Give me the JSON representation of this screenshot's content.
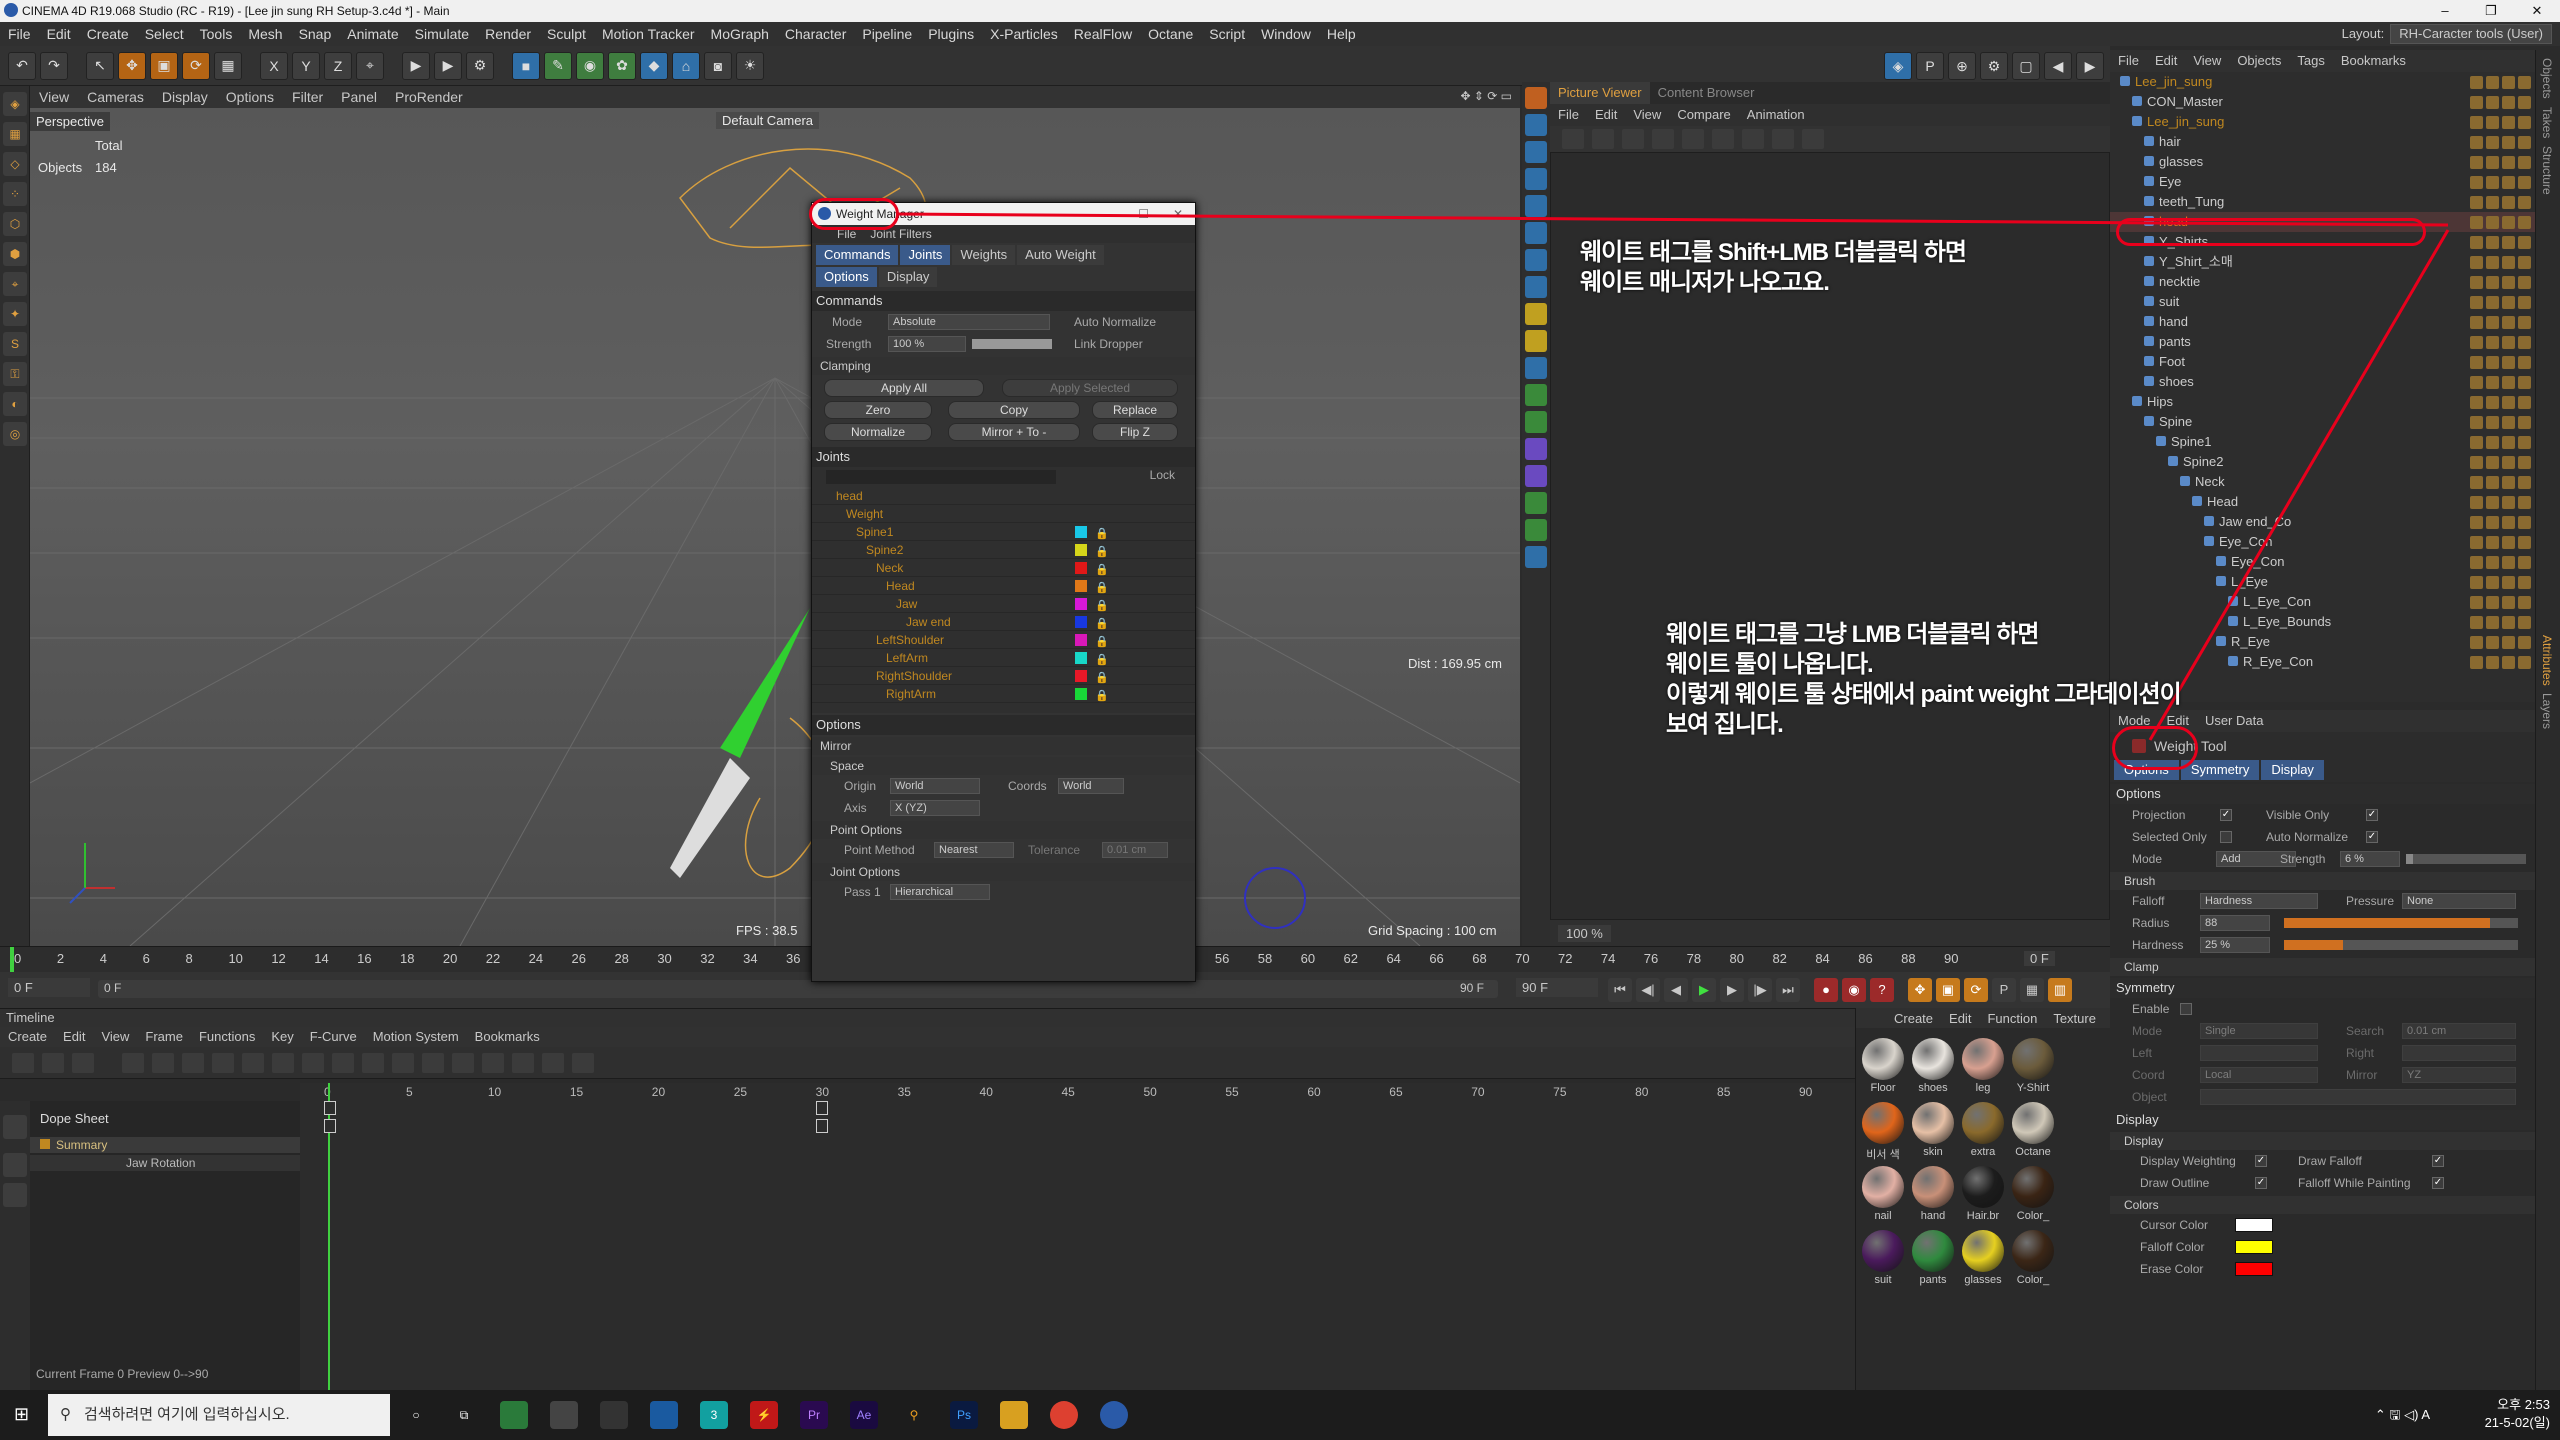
{
  "window": {
    "title": "CINEMA 4D R19.068 Studio (RC - R19) - [Lee jin sung RH Setup-3.c4d *] - Main",
    "min": "–",
    "max": "❐",
    "close": "✕"
  },
  "menubar": [
    "File",
    "Edit",
    "Create",
    "Select",
    "Tools",
    "Mesh",
    "Snap",
    "Animate",
    "Simulate",
    "Render",
    "Sculpt",
    "Motion Tracker",
    "MoGraph",
    "Character",
    "Pipeline",
    "Plugins",
    "X-Particles",
    "RealFlow",
    "Octane",
    "Script",
    "Window",
    "Help"
  ],
  "layout": {
    "label": "Layout:",
    "value": "RH-Caracter tools (User)"
  },
  "viewport": {
    "menu": [
      "View",
      "Cameras",
      "Display",
      "Options",
      "Filter",
      "Panel",
      "ProRender"
    ],
    "badge": "Perspective",
    "camera": "Default Camera",
    "stats_total": "Total",
    "stats_objects_label": "Objects",
    "stats_objects_value": "184",
    "fps": "FPS : 38.5",
    "dist": "Dist : 169.95 cm",
    "grid_spacing": "Grid Spacing : 100 cm"
  },
  "ruler": {
    "ticks": [
      "0",
      "2",
      "4",
      "6",
      "8",
      "10",
      "12",
      "14",
      "16",
      "18",
      "20",
      "22",
      "24",
      "26",
      "28",
      "30",
      "32",
      "34",
      "36",
      "38",
      "40",
      "42",
      "44",
      "46",
      "48",
      "50",
      "52",
      "54",
      "56",
      "58",
      "60",
      "62",
      "64",
      "66",
      "68",
      "70",
      "72",
      "74",
      "76",
      "78",
      "80",
      "82",
      "84",
      "86",
      "88",
      "90"
    ],
    "end": "0 F"
  },
  "playbar": {
    "start": "0 F",
    "slider_start": "0 F",
    "slider_end": "90 F",
    "end": "90 F"
  },
  "timeline": {
    "title": "Timeline",
    "menu": [
      "Create",
      "Edit",
      "View",
      "Frame",
      "Functions",
      "Key",
      "F-Curve",
      "Motion System",
      "Bookmarks"
    ],
    "dope_sheet": "Dope Sheet",
    "summary": "Summary",
    "track": "Jaw Rotation",
    "ruler": [
      "0",
      "5",
      "10",
      "15",
      "20",
      "25",
      "30",
      "35",
      "40",
      "45",
      "50",
      "55",
      "60",
      "65",
      "70",
      "75",
      "80",
      "85",
      "90"
    ],
    "status": "Current Frame  0  Preview  0-->90"
  },
  "materials": {
    "menu": [
      "Create",
      "Edit",
      "Function",
      "Texture"
    ],
    "items": [
      {
        "name": "Floor",
        "color": "#d9d4cc"
      },
      {
        "name": "shoes",
        "color": "#e8e4de"
      },
      {
        "name": "leg",
        "color": "#d8a090"
      },
      {
        "name": "Y-Shirt",
        "color": "#6b5b3b"
      },
      {
        "name": "비서 색",
        "color": "#e0651b"
      },
      {
        "name": "skin",
        "color": "#e6c0a6"
      },
      {
        "name": "extra",
        "color": "#8a6a2c"
      },
      {
        "name": "Octane",
        "color": "#d0c8b8"
      },
      {
        "name": "nail",
        "color": "#e2b0a4"
      },
      {
        "name": "hand",
        "color": "#c89078"
      },
      {
        "name": "Hair.br",
        "color": "#1c1c1c"
      },
      {
        "name": "Color_",
        "color": "#3a2414"
      },
      {
        "name": "suit",
        "color": "#4a1a5c"
      },
      {
        "name": "pants",
        "color": "#2f8a3e"
      },
      {
        "name": "glasses",
        "color": "#e6d020"
      },
      {
        "name": "Color_",
        "color": "#3b2616"
      }
    ]
  },
  "picture_viewer": {
    "tabs": [
      "Picture Viewer",
      "Content Browser"
    ],
    "menu": [
      "File",
      "Edit",
      "View",
      "Compare",
      "Animation"
    ],
    "zoom": "100 %"
  },
  "object_manager": {
    "menu": [
      "File",
      "Edit",
      "View",
      "Objects",
      "Tags",
      "Bookmarks"
    ],
    "items": [
      {
        "indent": 0,
        "name": "Lee_jin_sung",
        "color": "#c08820"
      },
      {
        "indent": 1,
        "name": "CON_Master",
        "color": "#cccccc"
      },
      {
        "indent": 1,
        "name": "Lee_jin_sung",
        "color": "#c08820"
      },
      {
        "indent": 2,
        "name": "hair",
        "color": "#cccccc"
      },
      {
        "indent": 2,
        "name": "glasses",
        "color": "#cccccc"
      },
      {
        "indent": 2,
        "name": "Eye",
        "color": "#cccccc"
      },
      {
        "indent": 2,
        "name": "teeth_Tung",
        "color": "#cccccc"
      },
      {
        "indent": 2,
        "name": "head",
        "color": "#e07020",
        "selected": true
      },
      {
        "indent": 2,
        "name": "Y_Shirts",
        "color": "#cccccc"
      },
      {
        "indent": 2,
        "name": "Y_Shirt_소매",
        "color": "#cccccc"
      },
      {
        "indent": 2,
        "name": "necktie",
        "color": "#cccccc"
      },
      {
        "indent": 2,
        "name": "suit",
        "color": "#cccccc"
      },
      {
        "indent": 2,
        "name": "hand",
        "color": "#cccccc"
      },
      {
        "indent": 2,
        "name": "pants",
        "color": "#cccccc"
      },
      {
        "indent": 2,
        "name": "Foot",
        "color": "#cccccc"
      },
      {
        "indent": 2,
        "name": "shoes",
        "color": "#cccccc"
      },
      {
        "indent": 1,
        "name": "Hips",
        "color": "#cccccc"
      },
      {
        "indent": 2,
        "name": "Spine",
        "color": "#cccccc"
      },
      {
        "indent": 3,
        "name": "Spine1",
        "color": "#cccccc"
      },
      {
        "indent": 4,
        "name": "Spine2",
        "color": "#cccccc"
      },
      {
        "indent": 5,
        "name": "Neck",
        "color": "#cccccc"
      },
      {
        "indent": 6,
        "name": "Head",
        "color": "#cccccc"
      },
      {
        "indent": 7,
        "name": "Jaw end_Co",
        "color": "#cccccc"
      },
      {
        "indent": 7,
        "name": "Eye_Con",
        "color": "#cccccc"
      },
      {
        "indent": 8,
        "name": "Eye_Con",
        "color": "#cccccc"
      },
      {
        "indent": 8,
        "name": "L_Eye",
        "color": "#cccccc"
      },
      {
        "indent": 9,
        "name": "L_Eye_Con",
        "color": "#cccccc"
      },
      {
        "indent": 9,
        "name": "L_Eye_Bounds",
        "color": "#cccccc"
      },
      {
        "indent": 8,
        "name": "R_Eye",
        "color": "#cccccc"
      },
      {
        "indent": 9,
        "name": "R_Eye_Con",
        "color": "#cccccc"
      }
    ]
  },
  "attributes": {
    "menu": [
      "Mode",
      "Edit",
      "User Data"
    ],
    "title": "Weight Tool",
    "tabs": [
      "Options",
      "Symmetry",
      "Display"
    ],
    "options_header": "Options",
    "projection": "Projection",
    "visible_only": "Visible Only",
    "selected_only": "Selected Only",
    "auto_normalize": "Auto Normalize",
    "mode_label": "Mode",
    "mode_value": "Add",
    "strength_label": "Strength",
    "strength_value": "6 %",
    "strength_level": 0.06,
    "brush_header": "Brush",
    "falloff_label": "Falloff",
    "falloff_value": "Hardness",
    "pressure_label": "Pressure",
    "pressure_value": "None",
    "radius_label": "Radius",
    "radius_value": "88",
    "radius_level": 0.88,
    "hardness_label": "Hardness",
    "hardness_value": "25 %",
    "hardness_level": 0.25,
    "clamp_header": "Clamp",
    "symmetry_header": "Symmetry",
    "enable": "Enable",
    "sym_mode_label": "Mode",
    "sym_mode_value": "Single",
    "search_label": "Search",
    "search_value": "0.01 cm",
    "left_label": "Left",
    "right_label": "Right",
    "coord_label": "Coord",
    "coord_value": "Local",
    "mirror_label": "Mirror",
    "mirror_value": "YZ",
    "object_label": "Object",
    "display_header": "Display",
    "display_sub": "Display",
    "display_weighting": "Display Weighting",
    "draw_falloff": "Draw Falloff",
    "draw_outline": "Draw Outline",
    "falloff_painting": "Falloff While Painting",
    "colors_header": "Colors",
    "cursor_color_label": "Cursor Color",
    "cursor_color": "#ffffff",
    "falloff_color_label": "Falloff Color",
    "falloff_color": "#ffff00",
    "erase_color_label": "Erase Color",
    "erase_color": "#ff0000"
  },
  "side_tabs": [
    "Objects",
    "Takes",
    "Structure",
    "Attributes",
    "Layers"
  ],
  "weight_manager": {
    "title": "Weight Manager",
    "menu": [
      "File",
      "Joint Filters"
    ],
    "tabs_row1": [
      "Commands",
      "Joints",
      "Weights",
      "Auto Weight"
    ],
    "tabs_row2": [
      "Options",
      "Display"
    ],
    "commands_header": "Commands",
    "mode_label": "Mode",
    "mode_value": "Absolute",
    "auto_normalize": "Auto Normalize",
    "strength_label": "Strength",
    "strength_value": "100 %",
    "link_dropper": "Link Dropper",
    "clamping": "Clamping",
    "apply_all": "Apply All",
    "apply_selected": "Apply Selected",
    "zero": "Zero",
    "copy": "Copy",
    "replace": "Replace",
    "normalize": "Normalize",
    "mirror": "Mirror + To -",
    "flip_z": "Flip Z",
    "joints_header": "Joints",
    "lock_label": "Lock",
    "joints": [
      {
        "name": "head",
        "indent": 0,
        "color": "",
        "type": "obj"
      },
      {
        "name": "Weight",
        "indent": 1,
        "color": "",
        "type": "tag"
      },
      {
        "name": "Spine1",
        "indent": 2,
        "color": "#19c8e8"
      },
      {
        "name": "Spine2",
        "indent": 3,
        "color": "#d6d61a"
      },
      {
        "name": "Neck",
        "indent": 4,
        "color": "#e01818"
      },
      {
        "name": "Head",
        "indent": 5,
        "color": "#e07818"
      },
      {
        "name": "Jaw",
        "indent": 6,
        "color": "#d818d8"
      },
      {
        "name": "Jaw end",
        "indent": 7,
        "color": "#1838e0"
      },
      {
        "name": "LeftShoulder",
        "indent": 4,
        "color": "#d818b8"
      },
      {
        "name": "LeftArm",
        "indent": 5,
        "color": "#18d8c8"
      },
      {
        "name": "RightShoulder",
        "indent": 4,
        "color": "#e81828"
      },
      {
        "name": "RightArm",
        "indent": 5,
        "color": "#18d838"
      }
    ],
    "options_header": "Options",
    "mirror_header": "Mirror",
    "space_header": "Space",
    "origin_label": "Origin",
    "origin_value": "World",
    "coords_label": "Coords",
    "coords_value": "World",
    "axis_label": "Axis",
    "axis_value": "X (YZ)",
    "point_options": "Point Options",
    "point_method_label": "Point Method",
    "point_method_value": "Nearest",
    "tolerance_label": "Tolerance",
    "tolerance_value": "0.01 cm",
    "joint_options": "Joint Options",
    "pass1_label": "Pass 1",
    "pass1_value": "Hierarchical"
  },
  "annotations": {
    "note1_line1": "웨이트 태그를 Shift+LMB 더블클릭 하면",
    "note1_line2": "웨이트 매니저가 나오고요.",
    "note2_line1": "웨이트 태그를 그냥 LMB 더블클릭 하면",
    "note2_line2": "웨이트 툴이 나옵니다.",
    "note2_line3": "이렇게 웨이트 툴 상태에서 paint weight 그라데이션이",
    "note2_line4": "보여 집니다."
  },
  "taskbar": {
    "search_placeholder": "검색하려면 여기에 입력하십시오.",
    "time": "오후 2:53",
    "date": "21-5-02(일)",
    "tray": "⌃ 🖫 ◁) A"
  },
  "colors": {
    "accent": "#3a5a8a",
    "annotation": "#e8001c",
    "joint_label": "#c08820"
  }
}
